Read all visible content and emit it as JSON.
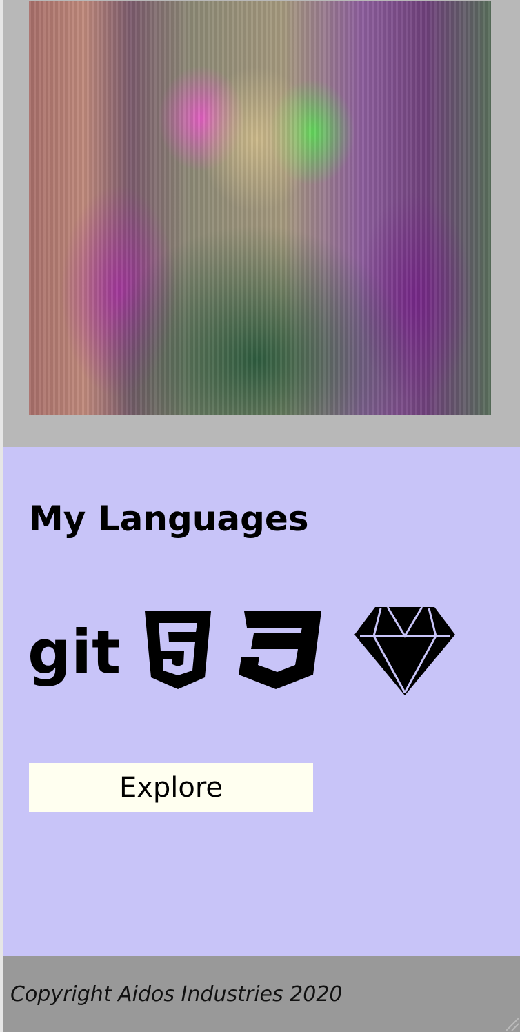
{
  "profile": {
    "photo_alt": "Profile photo"
  },
  "languages": {
    "heading": "My Languages",
    "icons": [
      "git-icon",
      "html5-icon",
      "css3-icon",
      "ruby-gem-icon"
    ],
    "git_logo_text": "git",
    "explore_label": "Explore"
  },
  "footer": {
    "copyright": "Copyright Aidos Industries 2020"
  },
  "colors": {
    "top_background": "#b8b8b8",
    "languages_background": "#c8c4f8",
    "button_background": "#fffff0",
    "footer_background": "#999999"
  }
}
